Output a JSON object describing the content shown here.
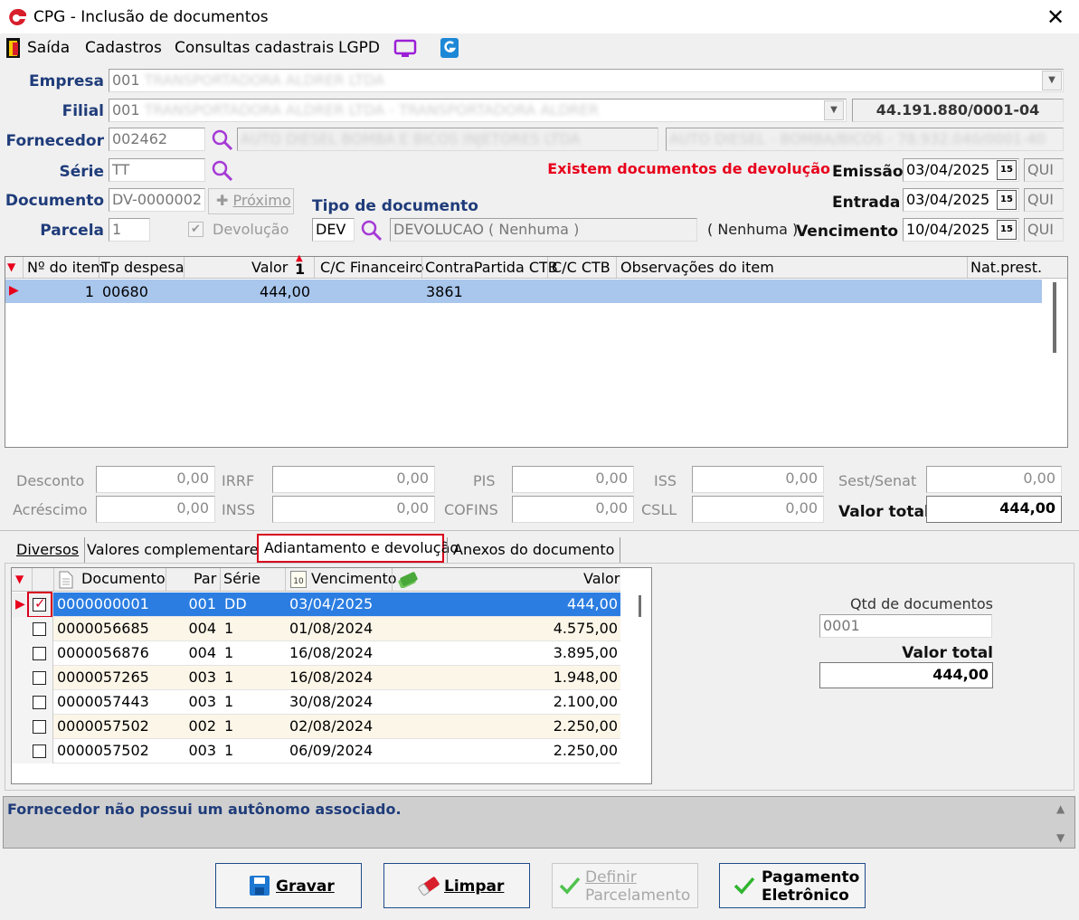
{
  "window": {
    "title": "CPG - Inclusão de documentos"
  },
  "menu": {
    "items": [
      "Saída",
      "Cadastros",
      "Consultas cadastrais",
      "LGPD"
    ]
  },
  "form": {
    "empresa_label": "Empresa",
    "empresa_code": "001",
    "empresa_name": "TRANSPORTADORA ALDRER LTDA",
    "filial_label": "Filial",
    "filial_code": "001",
    "filial_name": "TRANSPORTADORA ALDRER LTDA - TRANSPORTADORA ALDRER",
    "cnpj": "44.191.880/0001-04",
    "fornecedor_label": "Fornecedor",
    "fornecedor_code": "002462",
    "fornecedor_name": "AUTO DIESEL BOMBA E BICOS INJETORES LTDA",
    "fornecedor_name2": "AUTO DIESEL - BOMBA/BICOS - 78.932.040/0001-40",
    "serie_label": "Série",
    "serie_value": "TT",
    "warning_text": "Existem documentos de devolução",
    "emissao_label": "Emissão",
    "emissao_value": "03/04/2025",
    "emissao_day": "QUI",
    "entrada_label": "Entrada",
    "entrada_value": "03/04/2025",
    "entrada_day": "QUI",
    "vencimento_label": "Vencimento",
    "vencimento_value": "10/04/2025",
    "vencimento_day": "QUI",
    "documento_label": "Documento",
    "documento_value": "DV-0000002",
    "proximo_label": "Próximo",
    "tipo_label": "Tipo de documento",
    "tipo_code": "DEV",
    "tipo_desc": "DEVOLUCAO ( Nenhuma )",
    "tipo_extra": "( Nenhuma )",
    "parcela_label": "Parcela",
    "parcela_value": "1",
    "devolucao_label": "Devolução",
    "calendar_glyph": "15"
  },
  "items_grid": {
    "columns": [
      "Nº do item",
      "Tp despesa",
      "Valor",
      "C/C Financeiro",
      "ContraPartida CTB",
      "C/C CTB",
      "Observações do item",
      "Nat.prest."
    ],
    "sort_indicator": "1",
    "rows": [
      {
        "item": "1",
        "tp": "00680",
        "valor": "444,00",
        "ccf": "",
        "contra": "3861",
        "ccctb": "",
        "obs": "",
        "nat": ""
      }
    ]
  },
  "totals": {
    "desconto_label": "Desconto",
    "desconto": "0,00",
    "irrf_label": "IRRF",
    "irrf": "0,00",
    "pis_label": "PIS",
    "pis": "0,00",
    "iss_label": "ISS",
    "iss": "0,00",
    "sest_label": "Sest/Senat",
    "sest": "0,00",
    "acrescimo_label": "Acréscimo",
    "acrescimo": "0,00",
    "inss_label": "INSS",
    "inss": "0,00",
    "cofins_label": "COFINS",
    "cofins": "0,00",
    "csll_label": "CSLL",
    "csll": "0,00",
    "valor_total_label": "Valor total",
    "valor_total": "444,00"
  },
  "tabs": [
    "Diversos",
    "Valores complementares",
    "Adiantamento e devolução",
    "Anexos do documento"
  ],
  "adv_grid": {
    "columns": [
      "Documento",
      "Par",
      "Série",
      "Vencimento",
      "Valor"
    ],
    "calendar_glyph": "10",
    "rows": [
      {
        "checked": true,
        "doc": "0000000001",
        "par": "001",
        "serie": "DD",
        "venc": "03/04/2025",
        "valor": "444,00"
      },
      {
        "checked": false,
        "doc": "0000056685",
        "par": "004",
        "serie": "1",
        "venc": "01/08/2024",
        "valor": "4.575,00"
      },
      {
        "checked": false,
        "doc": "0000056876",
        "par": "004",
        "serie": "1",
        "venc": "16/08/2024",
        "valor": "3.895,00"
      },
      {
        "checked": false,
        "doc": "0000057265",
        "par": "003",
        "serie": "1",
        "venc": "16/08/2024",
        "valor": "1.948,00"
      },
      {
        "checked": false,
        "doc": "0000057443",
        "par": "003",
        "serie": "1",
        "venc": "30/08/2024",
        "valor": "2.100,00"
      },
      {
        "checked": false,
        "doc": "0000057502",
        "par": "002",
        "serie": "1",
        "venc": "02/08/2024",
        "valor": "2.250,00"
      },
      {
        "checked": false,
        "doc": "0000057502",
        "par": "003",
        "serie": "1",
        "venc": "06/09/2024",
        "valor": "2.250,00"
      }
    ]
  },
  "side": {
    "qtd_label": "Qtd de documentos",
    "qtd_value": "0001",
    "total_label": "Valor total",
    "total_value": "444,00"
  },
  "status": {
    "message": "Fornecedor não possui um autônomo associado."
  },
  "buttons": {
    "gravar": "Gravar",
    "limpar": "Limpar",
    "definir_1": "Definir",
    "definir_2": "Parcelamento",
    "pagamento_1": "Pagamento",
    "pagamento_2": "Eletrônico"
  },
  "colors": {
    "accent_blue": "#1f3c7a",
    "warning_red": "#e8001c",
    "selected_row": "#2b7de1",
    "grid_selected": "#a9c6ec"
  }
}
